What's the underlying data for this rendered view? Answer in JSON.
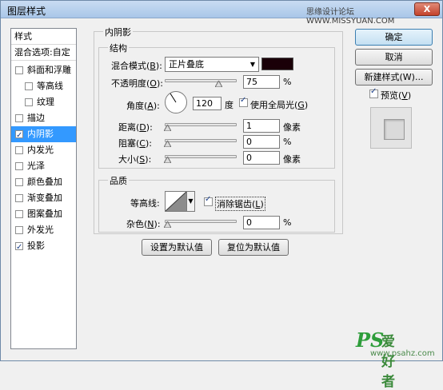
{
  "window": {
    "title": "图层样式",
    "watermark": "思缘设计论坛 WWW.MISSYUAN.COM",
    "close": "X"
  },
  "styles_list": {
    "items": [
      {
        "label": "样式",
        "type": "header"
      },
      {
        "label": "混合选项:自定",
        "type": "header"
      },
      {
        "label": "斜面和浮雕",
        "checked": false
      },
      {
        "label": "等高线",
        "checked": false,
        "indent": true
      },
      {
        "label": "纹理",
        "checked": false,
        "indent": true
      },
      {
        "label": "描边",
        "checked": false
      },
      {
        "label": "内阴影",
        "checked": true,
        "selected": true
      },
      {
        "label": "内发光",
        "checked": false
      },
      {
        "label": "光泽",
        "checked": false
      },
      {
        "label": "颜色叠加",
        "checked": false
      },
      {
        "label": "渐变叠加",
        "checked": false
      },
      {
        "label": "图案叠加",
        "checked": false
      },
      {
        "label": "外发光",
        "checked": false
      },
      {
        "label": "投影",
        "checked": true
      }
    ]
  },
  "panel": {
    "title": "内阴影",
    "structure": {
      "title": "结构",
      "blend_mode_label": "混合模式",
      "blend_mode_key": "B",
      "blend_mode_value": "正片叠底",
      "color": "#1a0008",
      "opacity_label": "不透明度",
      "opacity_key": "O",
      "opacity_value": "75",
      "opacity_unit": "%",
      "angle_label": "角度",
      "angle_key": "A",
      "angle_value": "120",
      "angle_unit": "度",
      "global_light_label": "使用全局光",
      "global_light_key": "G",
      "global_light_checked": true,
      "distance_label": "距离",
      "distance_key": "D",
      "distance_value": "1",
      "distance_unit": "像素",
      "choke_label": "阻塞",
      "choke_key": "C",
      "choke_value": "0",
      "choke_unit": "%",
      "size_label": "大小",
      "size_key": "S",
      "size_value": "0",
      "size_unit": "像素"
    },
    "quality": {
      "title": "品质",
      "contour_label": "等高线",
      "antialias_label": "消除锯齿",
      "antialias_key": "L",
      "antialias_checked": true,
      "noise_label": "杂色",
      "noise_key": "N",
      "noise_value": "0",
      "noise_unit": "%"
    },
    "set_default": "设置为默认值",
    "reset_default": "复位为默认值"
  },
  "buttons": {
    "ok": "确定",
    "cancel": "取消",
    "new_style": "新建样式(W)...",
    "preview_label": "预览",
    "preview_key": "V",
    "preview_checked": true
  },
  "watermark_bottom": {
    "ps": "PS",
    "cn": "爱好者",
    "url": "www.psahz.com"
  }
}
